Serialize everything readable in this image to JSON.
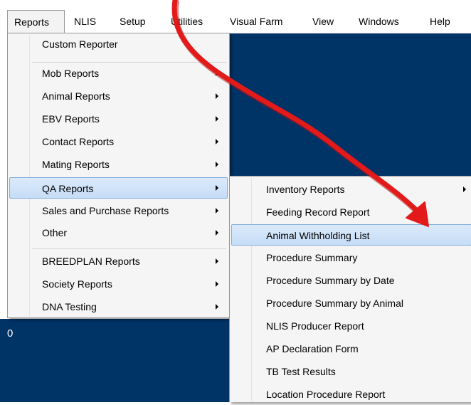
{
  "colors": {
    "workspace": "#003366",
    "menu_background": "#f5f5f5",
    "highlight": "#c6ddf7",
    "highlight_border": "#84acdd",
    "annotation_arrow": "#e21a1a"
  },
  "menubar": {
    "items": [
      "Reports",
      "NLIS",
      "Setup",
      "Utilities",
      "Visual Farm",
      "View",
      "Windows",
      "Help"
    ],
    "active": "Reports"
  },
  "reports_menu": {
    "items": [
      {
        "label": "Custom Reporter",
        "submenu": false
      },
      {
        "label": "Mob Reports",
        "submenu": true
      },
      {
        "label": "Animal Reports",
        "submenu": true
      },
      {
        "label": "EBV Reports",
        "submenu": true
      },
      {
        "label": "Contact Reports",
        "submenu": true
      },
      {
        "label": "Mating Reports",
        "submenu": true
      },
      {
        "label": "QA Reports",
        "submenu": true,
        "highlighted": true
      },
      {
        "label": "Sales and Purchase Reports",
        "submenu": true
      },
      {
        "label": "Other",
        "submenu": true
      },
      {
        "label": "BREEDPLAN Reports",
        "submenu": true
      },
      {
        "label": "Society Reports",
        "submenu": true
      },
      {
        "label": "DNA Testing",
        "submenu": true
      }
    ]
  },
  "qa_submenu": {
    "items": [
      {
        "label": "Inventory Reports",
        "submenu": true
      },
      {
        "label": "Feeding Record Report",
        "submenu": false
      },
      {
        "label": "Animal Withholding List",
        "submenu": false,
        "highlighted": true
      },
      {
        "label": "Procedure Summary",
        "submenu": false
      },
      {
        "label": "Procedure Summary by Date",
        "submenu": false
      },
      {
        "label": "Procedure Summary by Animal",
        "submenu": false
      },
      {
        "label": "NLIS Producer Report",
        "submenu": false
      },
      {
        "label": "AP Declaration Form",
        "submenu": false
      },
      {
        "label": "TB Test Results",
        "submenu": false
      },
      {
        "label": "Location Procedure Report",
        "submenu": false
      }
    ]
  },
  "background_text": "0"
}
